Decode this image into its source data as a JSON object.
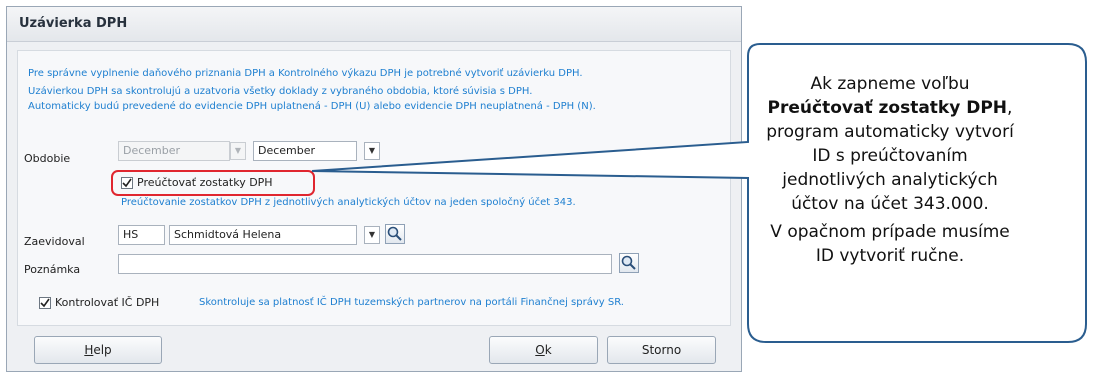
{
  "window": {
    "title": "Uzávierka DPH"
  },
  "info_lines": [
    "Pre správne vyplnenie daňového priznania DPH a Kontrolného výkazu DPH je potrebné vytvoriť uzávierku DPH.",
    "Uzávierkou DPH sa skontrolujú a uzatvoria všetky doklady z vybraného obdobia, ktoré súvisia s DPH.",
    "Automaticky budú prevedené do evidencie DPH uplatnená - DPH (U) alebo evidencie DPH neuplatnená - DPH (N)."
  ],
  "obdobie": {
    "label": "Obdobie",
    "from_value": "December",
    "to_value": "December"
  },
  "preuctovat": {
    "label": "Preúčtovať zostatky DPH",
    "checked": true,
    "hint": "Preúčtovanie zostatkov DPH z jednotlivých analytických účtov na jeden spoločný účet 343."
  },
  "zaevidoval": {
    "label": "Zaevidoval",
    "code": "HS",
    "name": "Schmidtová Helena"
  },
  "poznamka": {
    "label": "Poznámka",
    "value": ""
  },
  "kontrolovat": {
    "label": "Kontrolovať IČ DPH",
    "checked": true,
    "hint": "Skontroluje sa platnosť IČ DPH tuzemských partnerov na portáli Finančnej správy SR."
  },
  "buttons": {
    "help_u": "H",
    "help_rest": "elp",
    "ok_u": "O",
    "ok_rest": "k",
    "storno": "Storno"
  },
  "callout": {
    "line1": "Ak zapneme voľbu",
    "line2": "Preúčtovať zostatky DPH",
    "line2_suffix": ",",
    "line3": "program  automaticky vytvorí",
    "line4": "ID s preúčtovaním",
    "line5": "jednotlivých analytických",
    "line6": "účtov na účet 343.000.",
    "line7": "V opačnom prípade musíme",
    "line8": "ID vytvoriť ručne."
  },
  "icons": {
    "lookup": "magnifier-icon",
    "dropdown": "chevron-down-icon",
    "check": "checkmark-icon"
  }
}
